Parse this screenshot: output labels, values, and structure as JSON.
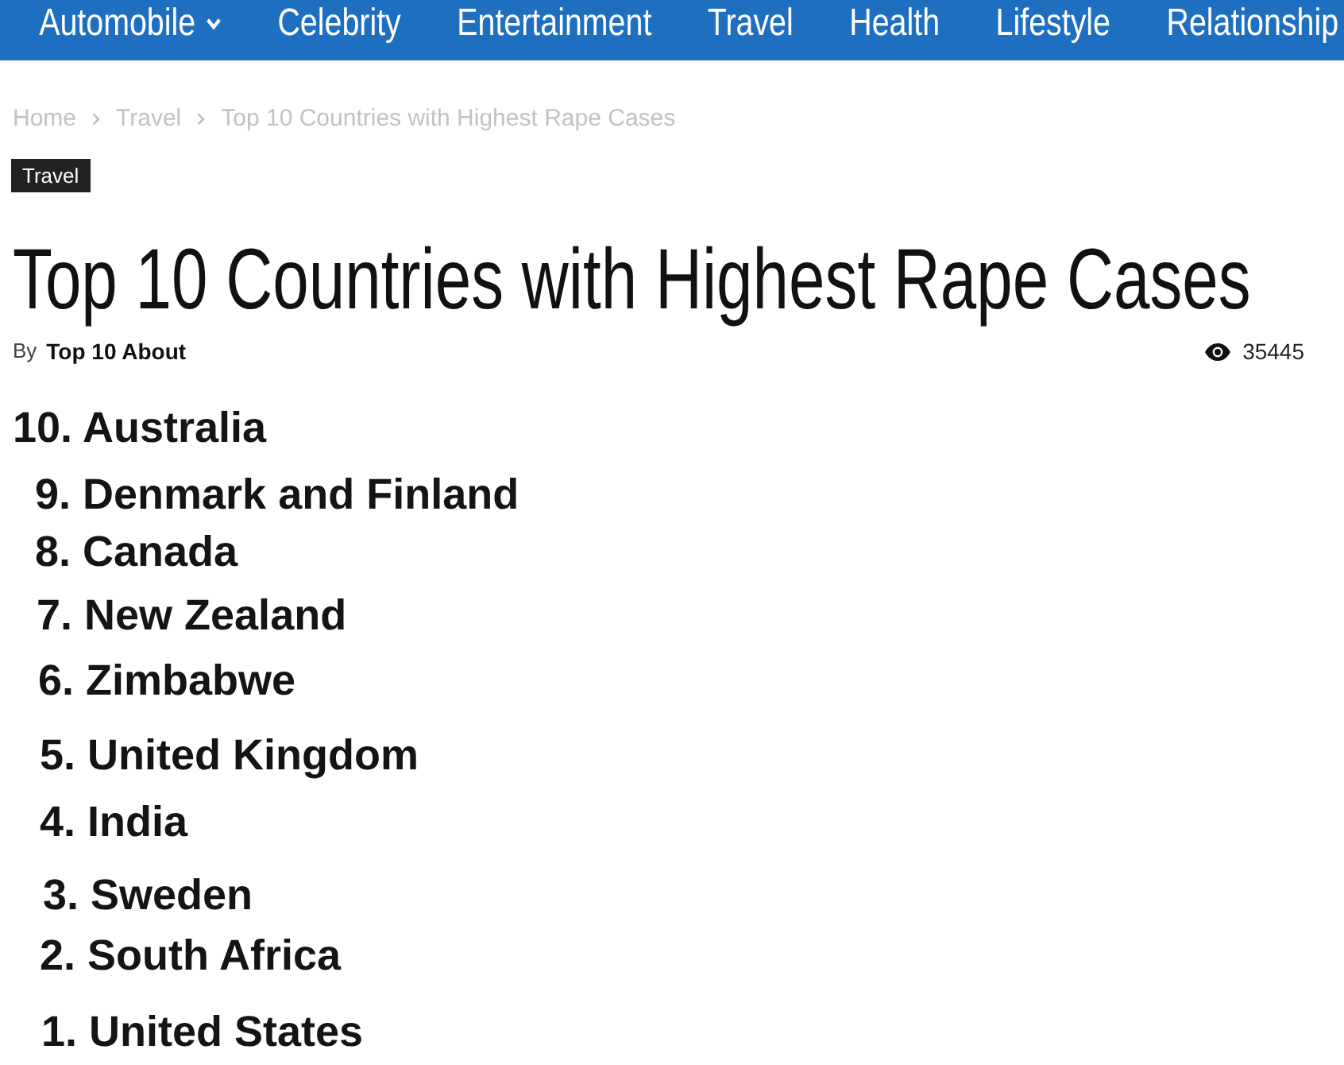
{
  "nav": {
    "items": [
      {
        "label": "Automobile",
        "has_dropdown": true
      },
      {
        "label": "Celebrity",
        "has_dropdown": false
      },
      {
        "label": "Entertainment",
        "has_dropdown": false
      },
      {
        "label": "Travel",
        "has_dropdown": false
      },
      {
        "label": "Health",
        "has_dropdown": false
      },
      {
        "label": "Lifestyle",
        "has_dropdown": false
      },
      {
        "label": "Relationship",
        "has_dropdown": false
      }
    ]
  },
  "breadcrumb": [
    "Home",
    "Travel",
    "Top 10 Countries with Highest Rape Cases"
  ],
  "category_tag": "Travel",
  "title": "Top 10 Countries with Highest Rape Cases",
  "byline": {
    "prefix": "By",
    "author": "Top 10 About"
  },
  "views": "35445",
  "list": [
    "10. Australia",
    "9. Denmark and Finland",
    "8. Canada",
    "7. New Zealand",
    "6. Zimbabwe",
    "5. United Kingdom",
    "4. India",
    "3. Sweden",
    "2. South Africa",
    "1. United States"
  ]
}
